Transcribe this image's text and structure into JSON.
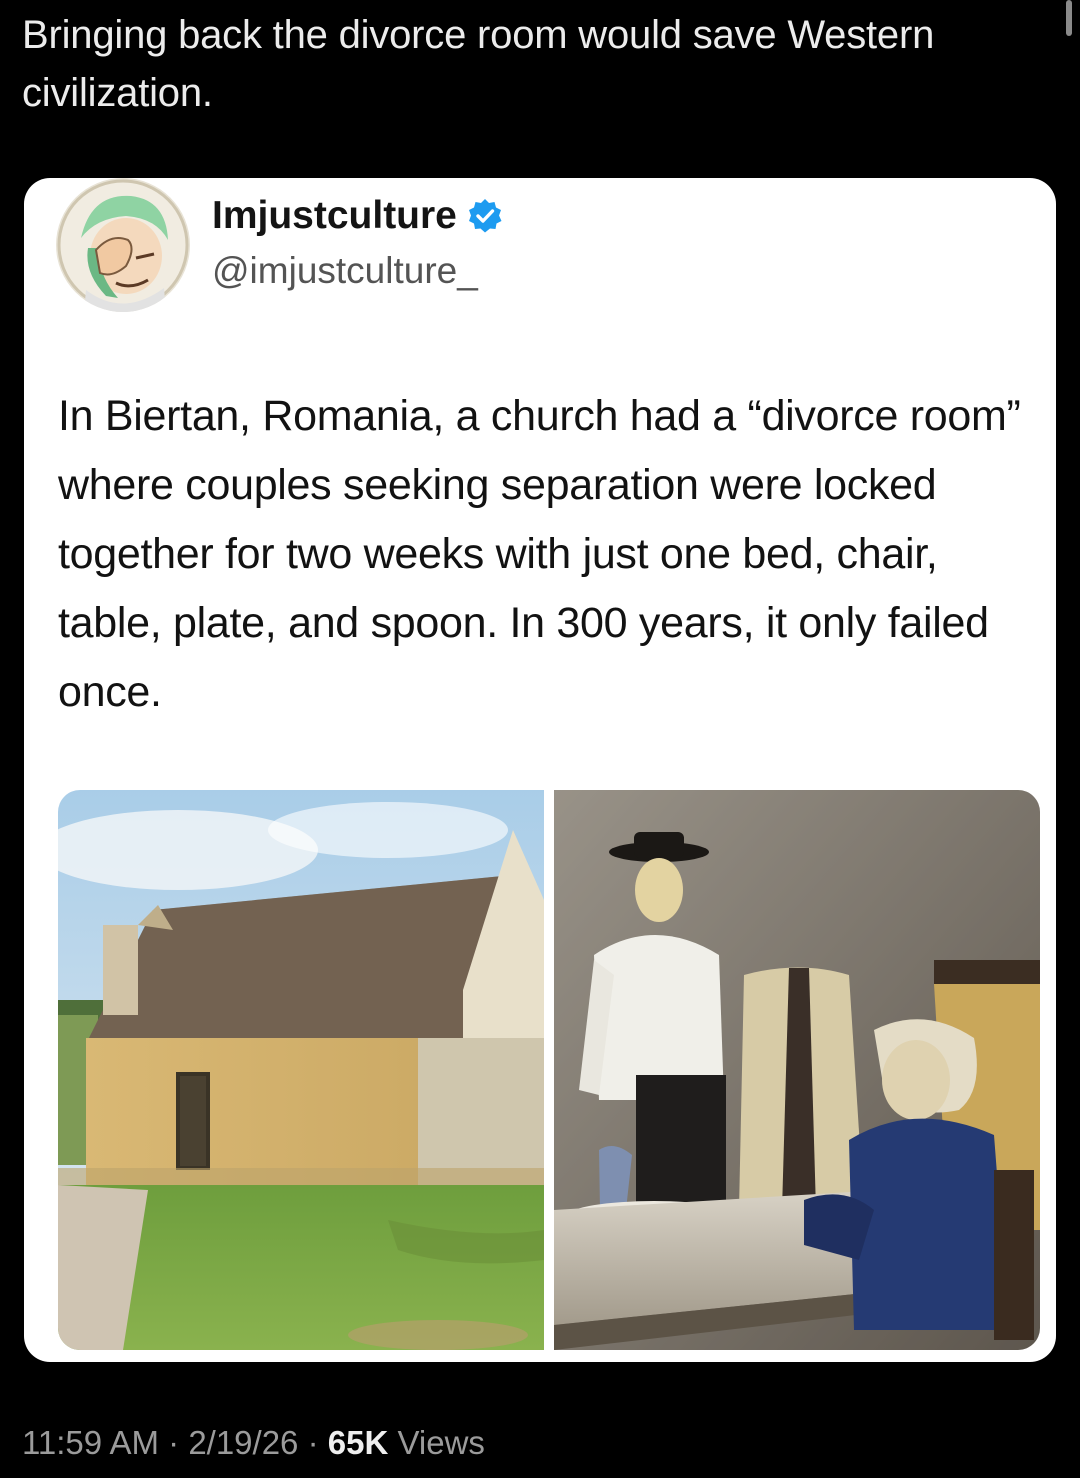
{
  "post": {
    "text": "Bringing back the divorce room would save Western civilization."
  },
  "quoted_tweet": {
    "author_name": "Imjustculture",
    "author_handle": "@imjustculture_",
    "verified_icon": "verified-badge-icon",
    "text": "In Biertan, Romania, a church had a “divorce room” where couples seeking separation were locked together for two weeks with just one bed, chair, table, plate, and spoon. In 300 years, it only failed once.",
    "images": [
      "stone-house-photo",
      "mannequins-interior-photo"
    ]
  },
  "meta": {
    "time": "11:59 AM",
    "sep1": " · ",
    "date": "2/19/26",
    "sep2": " · ",
    "views_count": "65K",
    "views_label": " Views"
  },
  "colors": {
    "background": "#000000",
    "card": "#ffffff",
    "verified": "#1d9bf0"
  }
}
